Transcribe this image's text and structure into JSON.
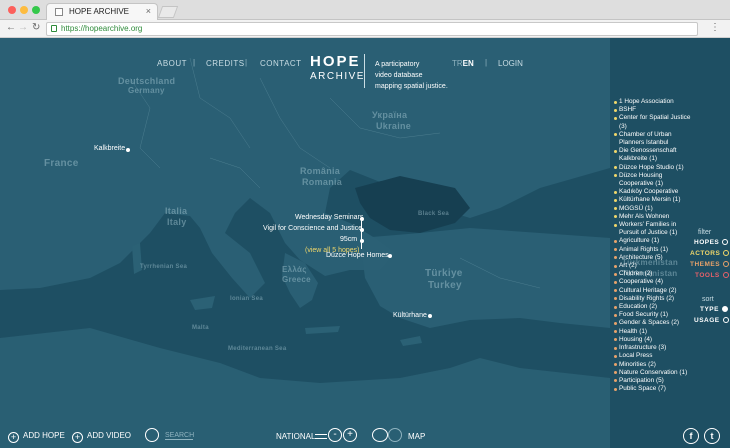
{
  "browser": {
    "tab_title": "HOPE ARCHIVE",
    "url": "https://hopearchive.org"
  },
  "nav": {
    "about": "ABOUT",
    "credits": "CREDITS",
    "contact": "CONTACT",
    "sep": "|",
    "lang_tr": "TR",
    "lang_en": "EN",
    "login": "LOGIN"
  },
  "logo": {
    "line1": "HOPE",
    "line2": "ARCHIVE",
    "tagline1": "A participatory",
    "tagline2": "video database",
    "tagline3": "mapping spatial justice."
  },
  "map_labels": {
    "deutschland": "Deutschland",
    "germany": "Germany",
    "france": "France",
    "romania": "România",
    "romania_en": "Romania",
    "ukraine_ua": "Україна",
    "ukraine": "Ukraine",
    "italia": "Italia",
    "italy": "Italy",
    "black_sea": "Black Sea",
    "turkiye": "Türkiye",
    "turkey": "Turkey",
    "hellas": "Ελλάς",
    "greece": "Greece",
    "tyrrhenian": "Tyrrhenian Sea",
    "ionian": "Ionian Sea",
    "mediterranean": "Mediterranean Sea",
    "malta": "Malta",
    "turkmenistan": "Türkmenistan",
    "turkmenistan_en": "Turkmenistan"
  },
  "points": {
    "kalkbreite": "Kalkbreite",
    "wednesday": "Wednesday Seminars",
    "vigil": "Vigil for Conscience and Justice",
    "c95": "95cm",
    "view_all": "(view all 5 hopes)",
    "duzce": "Düzce Hope Homes",
    "kulturhane": "Kültürhane"
  },
  "actors": [
    "1 Hope Association",
    "BSHF",
    "Center for Spatial Justice (3)",
    "Chamber of Urban Planners Istanbul",
    "Die Genossenschaft Kalkbreite (1)",
    "Düzce Hope Studio (1)",
    "Düzce Housing Cooperative (1)",
    "Kadıköy Cooperative",
    "Kültürhane Mersin (1)",
    "MGGSÜ (1)",
    "Mehr Als Wohnen",
    "Workers' Families in Pursuit of Justice (1)"
  ],
  "themes": [
    "Agriculture (1)",
    "Animal Rights (1)",
    "Architecture (5)",
    "Art (2)",
    "Children (2)",
    "Cooperative (4)",
    "Cultural Heritage (2)",
    "Disability Rights (2)",
    "Education (2)",
    "Food Security (1)",
    "Gender & Spaces (2)",
    "Health (1)",
    "Housing (4)",
    "Infrastructure (3)",
    "Local Press",
    "Minorities (2)",
    "Nature Conservation (1)",
    "Participation (5)",
    "Public Space (7)"
  ],
  "filter": {
    "title": "filter",
    "hopes": "HOPES",
    "actors": "ACTORS",
    "themes": "THEMES",
    "tools": "TOOLS",
    "colors": {
      "hopes": "#ffffff",
      "actors": "#f0d76a",
      "themes": "#e8a26a",
      "tools": "#e8606a"
    }
  },
  "sort": {
    "title": "sort",
    "type": "TYPE",
    "usage": "USAGE"
  },
  "bottom": {
    "add_hope": "ADD HOPE",
    "add_video": "ADD VIDEO",
    "search": "SEARCH",
    "national": "NATIONAL",
    "zoom_out": "-",
    "zoom_in": "+",
    "map": "MAP",
    "facebook": "f",
    "twitter": "t"
  }
}
